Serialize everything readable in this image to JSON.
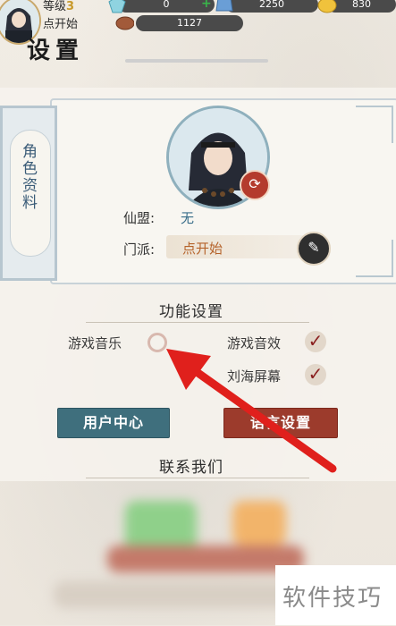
{
  "hud": {
    "level_label": "等级",
    "level_value": "3",
    "player_name": "点开始",
    "exp_value": "1127",
    "jade_value": "0",
    "gem_value": "2250",
    "gold_value": "830",
    "add_label": "+"
  },
  "header": {
    "title": "设置"
  },
  "profile": {
    "side_tab_label": "角色资料",
    "alliance_label": "仙盟:",
    "alliance_value": "无",
    "sect_label": "门派:",
    "sect_value": "点开始"
  },
  "settings": {
    "section_title": "功能设置",
    "music_label": "游戏音乐",
    "music_enabled": false,
    "sfx_label": "游戏音效",
    "sfx_enabled": true,
    "notch_label": "刘海屏幕",
    "notch_enabled": true,
    "user_center_label": "用户中心",
    "language_label": "语言设置"
  },
  "contact": {
    "section_title": "联系我们"
  },
  "watermark": {
    "text": "软件技巧"
  },
  "colors": {
    "accent_teal": "#3f6f7d",
    "accent_red": "#9c3b2c",
    "arrow_red": "#e0201c"
  },
  "icons": {
    "swap": "swap-icon",
    "brush": "brush-icon",
    "check": "check-icon"
  }
}
